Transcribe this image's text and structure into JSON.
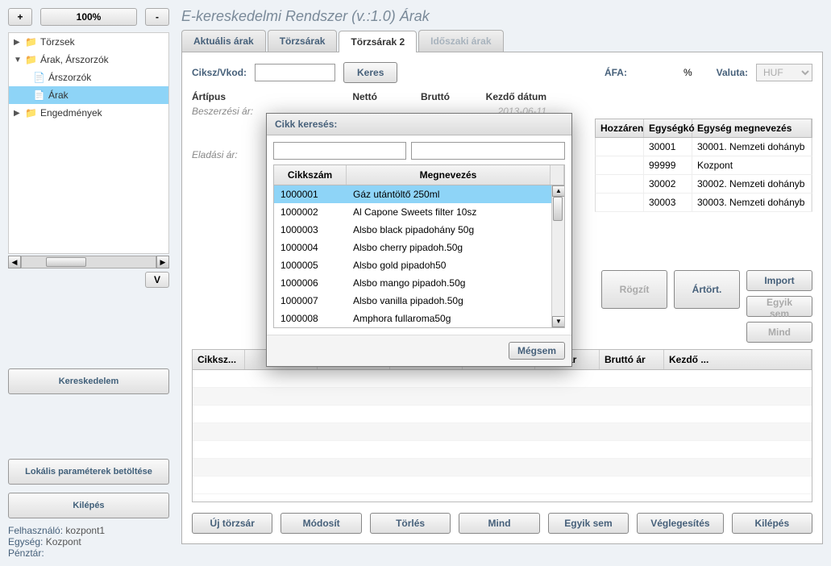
{
  "zoom": {
    "minus": "-",
    "plus": "+",
    "pct": "100%"
  },
  "tree": {
    "torzsek": "Törzsek",
    "arak_arszorzok": "Árak, Árszorzók",
    "arszorzok": "Árszorzók",
    "arak": "Árak",
    "engedmenyek": "Engedmények"
  },
  "v_btn": "V",
  "side": {
    "kereskedelem": "Kereskedelem",
    "lokalis": "Lokális paraméterek betöltése",
    "kilepes": "Kilépés"
  },
  "status": {
    "user_lbl": "Felhasználó:",
    "user_val": "kozpont1",
    "unit_lbl": "Egység:",
    "unit_val": "Kozpont",
    "cash_lbl": "Pénztár:",
    "cash_val": ""
  },
  "title": "E-kereskedelmi Rendszer (v.:1.0)   Árak",
  "tabs": {
    "aktualis": "Aktuális árak",
    "torzsarak": "Törzsárak",
    "torzsarak2": "Törzsárak 2",
    "idoszaki": "Időszaki árak"
  },
  "form": {
    "ciksz_label": "Ciksz/Vkod:",
    "keres": "Keres",
    "afa_label": "ÁFA:",
    "afa_pct": "%",
    "valuta_label": "Valuta:",
    "valuta_value": "HUF"
  },
  "price_header": {
    "artipus": "Ártípus",
    "netto": "Nettó",
    "brutto": "Bruttó",
    "kezdo": "Kezdő dátum"
  },
  "price_rows": {
    "beszerzesi": "Beszerzési ár:",
    "eladasi": "Eladási ár:",
    "date_placeholder": "2013-06-11"
  },
  "right_table": {
    "head": {
      "c1": "Hozzáren",
      "c2": "Egységkó",
      "c3": "Egység megnevezés"
    },
    "rows": [
      {
        "c2": "30001",
        "c3": "30001. Nemzeti dohányb"
      },
      {
        "c2": "99999",
        "c3": "Kozpont"
      },
      {
        "c2": "30002",
        "c3": "30002. Nemzeti dohányb"
      },
      {
        "c2": "30003",
        "c3": "30003. Nemzeti dohányb"
      }
    ]
  },
  "mid_buttons": {
    "import": "Import",
    "rogzit": "Rögzít",
    "artort": "Ártört.",
    "egyik_sem": "Egyik sem",
    "mind": "Mind"
  },
  "bottom_head": {
    "c1": "Cikksz...",
    "c2": "",
    "c3": "",
    "c4": "",
    "c5": "",
    "c6": "Nettó ár",
    "c7": "Bruttó ár",
    "c8": "Kezdő ..."
  },
  "bottom_buttons": {
    "uj": "Új törzsár",
    "modosit": "Módosít",
    "torles": "Törlés",
    "mind": "Mind",
    "egyik_sem": "Egyik sem",
    "veglegesites": "Véglegesítés",
    "kilepes": "Kilépés"
  },
  "popup": {
    "title": "Cikk keresés:",
    "head": {
      "c1": "Cikkszám",
      "c2": "Megnevezés"
    },
    "rows": [
      {
        "c1": "1000001",
        "c2": "Gáz utántöltő 250ml"
      },
      {
        "c1": "1000002",
        "c2": "Al Capone Sweets filter 10sz"
      },
      {
        "c1": "1000003",
        "c2": "Alsbo black pipadohány 50g"
      },
      {
        "c1": "1000004",
        "c2": "Alsbo cherry pipadoh.50g"
      },
      {
        "c1": "1000005",
        "c2": "Alsbo gold pipadoh50"
      },
      {
        "c1": "1000006",
        "c2": "Alsbo mango pipadoh.50g"
      },
      {
        "c1": "1000007",
        "c2": "Alsbo vanilla pipadoh.50g"
      },
      {
        "c1": "1000008",
        "c2": "Amphora fullaroma50g"
      }
    ],
    "megsem": "Mégsem"
  }
}
